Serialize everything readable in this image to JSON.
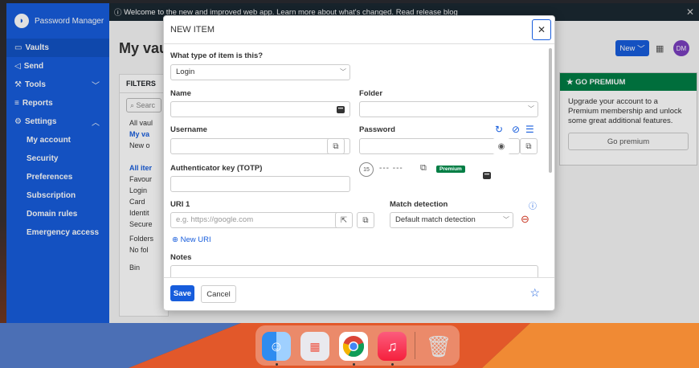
{
  "banner": {
    "text": "Welcome to the new and improved web app. Learn more about what's changed.",
    "link": "Read release blog"
  },
  "sidebar": {
    "brand": "Password Manager",
    "items": [
      {
        "label": "Vaults",
        "icon": "vault-icon"
      },
      {
        "label": "Send",
        "icon": "send-icon"
      },
      {
        "label": "Tools",
        "icon": "tools-icon"
      },
      {
        "label": "Reports",
        "icon": "reports-icon"
      },
      {
        "label": "Settings",
        "icon": "gear-icon"
      },
      {
        "label": "My account"
      },
      {
        "label": "Security"
      },
      {
        "label": "Preferences"
      },
      {
        "label": "Subscription"
      },
      {
        "label": "Domain rules"
      },
      {
        "label": "Emergency access"
      }
    ]
  },
  "main": {
    "title": "My vau",
    "new_label": "New",
    "avatar": "DM",
    "filters": {
      "header": "FILTERS",
      "search_placeholder": "Searc",
      "rows": [
        "All vaul",
        "My va",
        "New o",
        "All iter",
        "Favour",
        "Login",
        "Card",
        "Identit",
        "Secure",
        "Folders",
        "No fol",
        "Bin"
      ]
    },
    "premium": {
      "title": "GO PREMIUM",
      "text": "Upgrade your account to a Premium membership and unlock some great additional features.",
      "button": "Go premium"
    }
  },
  "modal": {
    "title": "NEW ITEM",
    "type_label": "What type of item is this?",
    "type_value": "Login",
    "name_label": "Name",
    "folder_label": "Folder",
    "username_label": "Username",
    "password_label": "Password",
    "totp_label": "Authenticator key (TOTP)",
    "totp_seconds": "15",
    "totp_code": "--- ---",
    "premium_badge": "Premium",
    "uri_label": "URI 1",
    "uri_placeholder": "e.g. https://google.com",
    "match_label": "Match detection",
    "match_value": "Default match detection",
    "new_uri": "New URI",
    "notes_label": "Notes",
    "save": "Save",
    "cancel": "Cancel"
  },
  "dock": {
    "apps": [
      "finder-icon",
      "launchpad-icon",
      "chrome-icon",
      "music-icon",
      "trash-icon"
    ]
  }
}
